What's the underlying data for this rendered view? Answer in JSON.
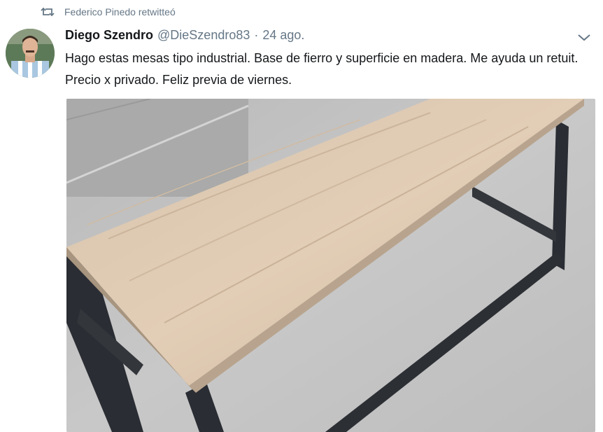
{
  "retweet": {
    "label": "Federico Pinedo retwitteó",
    "icon": "retweet-icon"
  },
  "tweet": {
    "author_name": "Diego Szendro",
    "author_handle": "@DieSzendro83",
    "separator": "·",
    "date": "24 ago.",
    "text": "Hago estas mesas tipo industrial. Base de fierro y superficie en madera. Me ayuda un retuit. Precio x privado. Feliz previa de viernes.",
    "menu_icon": "chevron-down-icon"
  },
  "colors": {
    "secondary_text": "#657786",
    "primary_text": "#14171a"
  }
}
